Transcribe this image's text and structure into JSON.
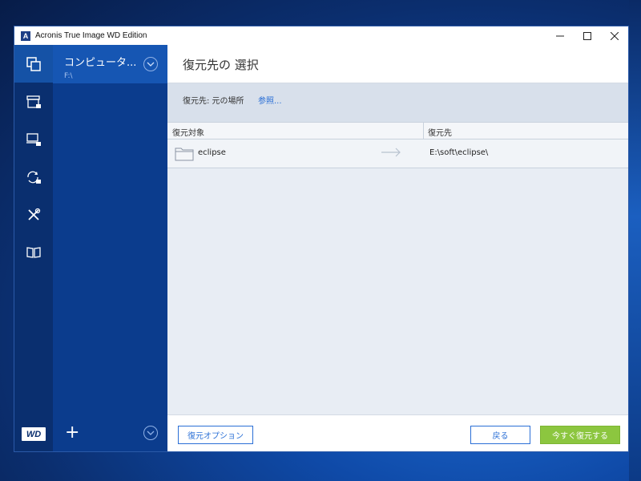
{
  "window": {
    "title": "Acronis True Image WD Edition",
    "logo_letter": "A",
    "controls": {
      "minimize": "—",
      "maximize": "☐",
      "close": "✕"
    }
  },
  "iconbar": {
    "items": [
      {
        "name": "backup-icon",
        "active": true
      },
      {
        "name": "archive-icon",
        "active": false
      },
      {
        "name": "sync-computer-icon",
        "active": false
      },
      {
        "name": "sync-icon",
        "active": false
      },
      {
        "name": "tools-icon",
        "active": false
      },
      {
        "name": "book-icon",
        "active": false
      }
    ],
    "brand": "WD"
  },
  "sidebar": {
    "selected": {
      "title": "コンピュータ...",
      "subtitle": "F:\\"
    },
    "add_label": "+"
  },
  "main": {
    "title": "復元先の 選択",
    "destination": {
      "label": "復元先:  元の場所",
      "browse_link": "参照..."
    },
    "table": {
      "columns": [
        "復元対象",
        "復元先"
      ],
      "rows": [
        {
          "name": "eclipse",
          "destination": "E:\\soft\\eclipse\\"
        }
      ]
    },
    "footer": {
      "options_button": "復元オプション",
      "back_button": "戻る",
      "recover_button": "今すぐ復元する"
    }
  },
  "colors": {
    "accent": "#2a6fd6",
    "sidebar": "#0b3c8d",
    "iconbar": "#0a2f6f",
    "selected": "#1656b3",
    "primary_button": "#8cc63f"
  }
}
